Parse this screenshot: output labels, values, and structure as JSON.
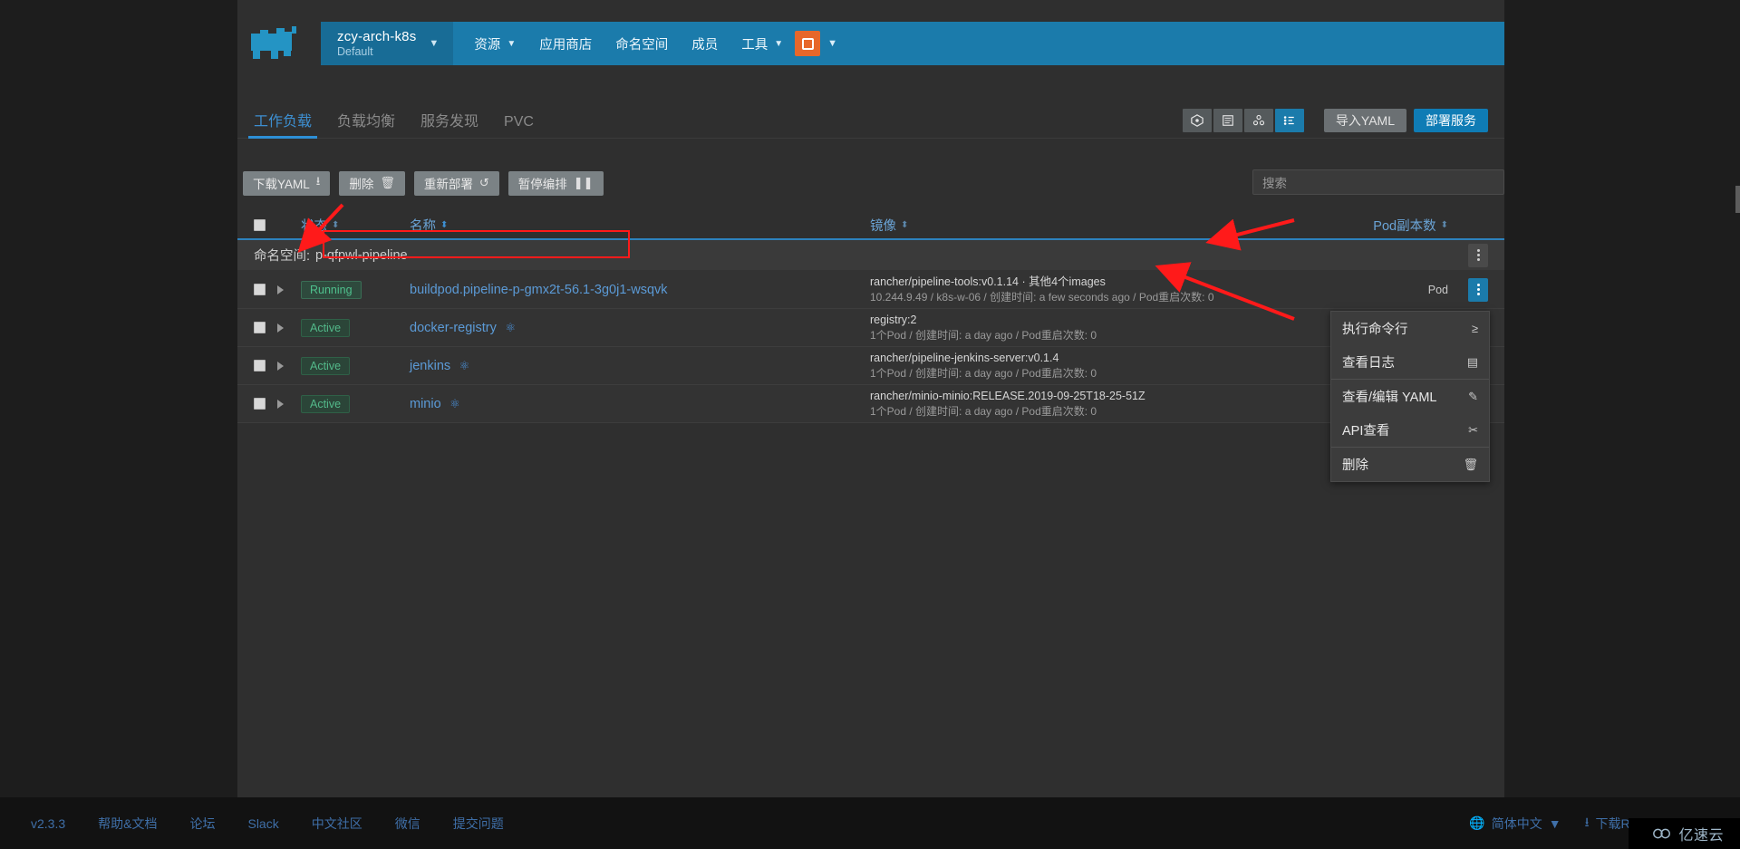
{
  "header": {
    "logo_name": "rancher-cow-logo",
    "cluster": {
      "name": "zcy-arch-k8s",
      "sub": "Default"
    },
    "nav": [
      {
        "label": "资源",
        "caret": true
      },
      {
        "label": "应用商店",
        "caret": false
      },
      {
        "label": "命名空间",
        "caret": false
      },
      {
        "label": "成员",
        "caret": false
      },
      {
        "label": "工具",
        "caret": true
      }
    ]
  },
  "tabs": [
    {
      "label": "工作负载",
      "active": true
    },
    {
      "label": "负载均衡",
      "active": false
    },
    {
      "label": "服务发现",
      "active": false
    },
    {
      "label": "PVC",
      "active": false
    }
  ],
  "view_buttons": [
    {
      "name": "cluster-view-icon",
      "selected": false
    },
    {
      "name": "list-view-icon",
      "selected": false
    },
    {
      "name": "group-view-icon",
      "selected": false
    },
    {
      "name": "detail-view-icon",
      "selected": true
    }
  ],
  "actions": {
    "import_yaml": "导入YAML",
    "deploy_service": "部署服务"
  },
  "toolbar": {
    "buttons": [
      {
        "label": "下载YAML",
        "icon": "download-icon",
        "glyph": "⭳"
      },
      {
        "label": "删除",
        "icon": "trash-icon",
        "glyph": "🗑"
      },
      {
        "label": "重新部署",
        "icon": "redeploy-icon",
        "glyph": "↺"
      },
      {
        "label": "暂停编排",
        "icon": "pause-icon",
        "glyph": "❚❚"
      }
    ],
    "search_placeholder": "搜索"
  },
  "table": {
    "columns": [
      {
        "key": "state",
        "label": "状态",
        "sorted": false
      },
      {
        "key": "name",
        "label": "名称",
        "sorted": true
      },
      {
        "key": "image",
        "label": "镜像",
        "sorted": false
      },
      {
        "key": "pods",
        "label": "Pod副本数",
        "sorted": false
      }
    ],
    "group": {
      "prefix": "命名空间:",
      "value": "p-qfpwl-pipeline"
    },
    "rows": [
      {
        "state": "Running",
        "state_kind": "running",
        "name": "buildpod.pipeline-p-gmx2t-56.1-3g0j1-wsqvk",
        "has_service_icon": false,
        "image": "rancher/pipeline-tools:v0.1.14 · 其他4个images",
        "sub": "10.244.9.49 / k8s-w-06 / 创建时间: a few seconds ago / Pod重启次数: 0",
        "pods": "Pod",
        "menu_open": true
      },
      {
        "state": "Active",
        "state_kind": "active",
        "name": "docker-registry",
        "has_service_icon": true,
        "image": "registry:2",
        "sub": "1个Pod / 创建时间: a day ago / Pod重启次数: 0",
        "pods": "",
        "menu_open": false
      },
      {
        "state": "Active",
        "state_kind": "active",
        "name": "jenkins",
        "has_service_icon": true,
        "image": "rancher/pipeline-jenkins-server:v0.1.4",
        "sub": "1个Pod / 创建时间: a day ago / Pod重启次数: 0",
        "pods": "",
        "menu_open": false
      },
      {
        "state": "Active",
        "state_kind": "active",
        "name": "minio",
        "has_service_icon": true,
        "image": "rancher/minio-minio:RELEASE.2019-09-25T18-25-51Z",
        "sub": "1个Pod / 创建时间: a day ago / Pod重启次数: 0",
        "pods": "",
        "menu_open": false
      }
    ]
  },
  "context_menu": {
    "items": [
      {
        "label": "执行命令行",
        "icon": "terminal-icon",
        "glyph": "≥"
      },
      {
        "label": "查看日志",
        "icon": "log-file-icon",
        "glyph": "▤"
      },
      {
        "label": "查看/编辑 YAML",
        "icon": "pencil-icon",
        "glyph": "✎"
      },
      {
        "label": "API查看",
        "icon": "api-tools-icon",
        "glyph": "✂"
      },
      {
        "label": "删除",
        "icon": "trash-icon",
        "glyph": "🗑"
      }
    ],
    "separators_after": [
      1,
      3
    ]
  },
  "footer": {
    "version": "v2.3.3",
    "links": [
      "帮助&文档",
      "论坛",
      "Slack",
      "中文社区",
      "微信",
      "提交问题"
    ],
    "language": "简体中文",
    "cli_download": "下载Rancher CLI",
    "watermark": "亿速云"
  },
  "colors": {
    "brand_blue": "#1b7bab",
    "accent_blue": "#2d8fd5",
    "link_blue": "#5b9ad6",
    "success_green": "#4fc08d",
    "annotation_red": "#ff1a1a",
    "avatar_orange": "#e7672a"
  }
}
